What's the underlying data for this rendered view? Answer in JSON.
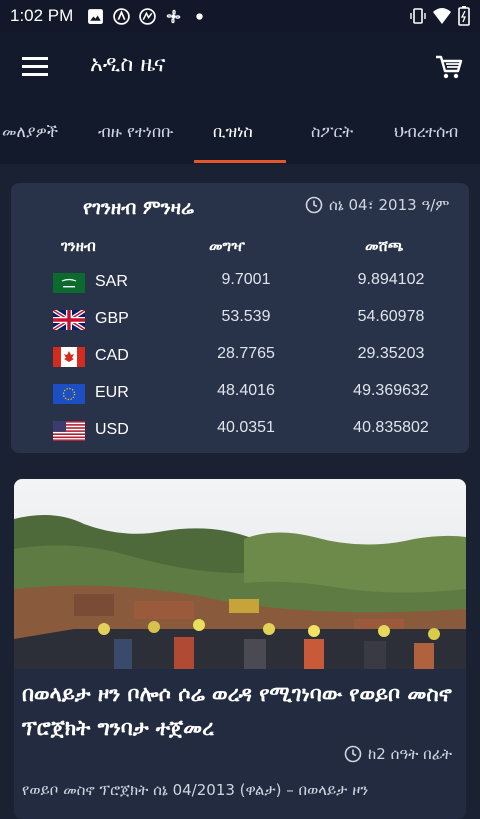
{
  "status_bar": {
    "time": "1:02 PM",
    "notification_icons": [
      "image-icon",
      "vpn-icon",
      "vpn-icon",
      "fan-icon",
      "dot-icon"
    ],
    "system_icons": [
      "vibrate-icon",
      "wifi-icon",
      "battery-icon"
    ]
  },
  "app_bar": {
    "title": "አዲስ ዜና",
    "menu_icon": "hamburger-menu-icon",
    "cart_icon": "cart-icon"
  },
  "tabs": {
    "items": [
      {
        "label": "መለያዎች",
        "active": false
      },
      {
        "label": "ብዙ የተነበቡ",
        "active": false
      },
      {
        "label": "ቢዝነስ",
        "active": true
      },
      {
        "label": "ስፖርት",
        "active": false
      },
      {
        "label": "ህብረተሰብ",
        "active": false
      }
    ],
    "indicator_color": "#e5562c"
  },
  "exchange": {
    "title": "የገንዘብ ምንዛሬ",
    "date": "ሰኔ 04፣ 2013 ዓ/ም",
    "col_currency": "ገንዘብ",
    "col_buy": "መግዣ",
    "col_sell": "መሸጫ",
    "rows": [
      {
        "code": "SAR",
        "flag": "saudi-arabia-flag",
        "buy": "9.7001",
        "sell": "9.894102"
      },
      {
        "code": "GBP",
        "flag": "uk-flag",
        "buy": "53.539",
        "sell": "54.60978"
      },
      {
        "code": "CAD",
        "flag": "canada-flag",
        "buy": "28.7765",
        "sell": "29.35203"
      },
      {
        "code": "EUR",
        "flag": "eu-flag",
        "buy": "48.4016",
        "sell": "49.369632"
      },
      {
        "code": "USD",
        "flag": "us-flag",
        "buy": "40.0351",
        "sell": "40.835802"
      }
    ]
  },
  "news": {
    "headline": "በወላይታ ዞን ቦሎሶ ሶሬ ወረዳ የሚገነባው የወይቦ መስኖ ፕሮጀክት ግንባታ ተጀመረ",
    "time_ago": "ከ2 ሰዓት በፊት",
    "summary": "የወይቦ መስኖ ፕሮጀክት ሰኔ 04/2013 (ዋልታ) – በወላይታ ዞን"
  },
  "colors": {
    "background": "#1a2133",
    "app_bar": "#131a2c",
    "card": "#28334a",
    "accent": "#e5562c"
  }
}
